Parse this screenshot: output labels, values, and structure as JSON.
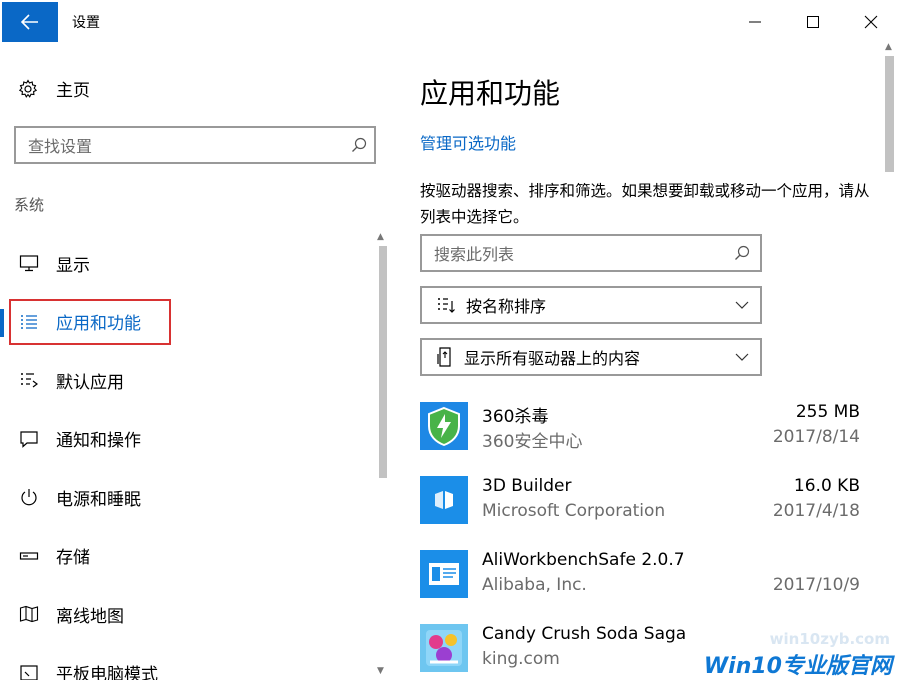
{
  "window": {
    "title": "设置",
    "back_icon": "back-arrow-icon",
    "accent": "#0a68c6"
  },
  "left": {
    "home_label": "主页",
    "search_placeholder": "查找设置",
    "section": "系统",
    "items": [
      {
        "label": "显示",
        "icon": "display-icon"
      },
      {
        "label": "应用和功能",
        "icon": "apps-list-icon",
        "selected": true
      },
      {
        "label": "默认应用",
        "icon": "default-apps-icon"
      },
      {
        "label": "通知和操作",
        "icon": "notification-icon"
      },
      {
        "label": "电源和睡眠",
        "icon": "power-icon"
      },
      {
        "label": "存储",
        "icon": "storage-icon"
      },
      {
        "label": "离线地图",
        "icon": "map-icon"
      },
      {
        "label": "平板电脑模式",
        "icon": "tablet-icon"
      }
    ]
  },
  "right": {
    "title": "应用和功能",
    "manage_link": "管理可选功能",
    "description": "按驱动器搜索、排序和筛选。如果想要卸载或移动一个应用，请从列表中选择它。",
    "search_placeholder": "搜索此列表",
    "sort_label": "按名称排序",
    "drive_label": "显示所有驱动器上的内容",
    "apps": [
      {
        "name": "360杀毒",
        "publisher": "360安全中心",
        "size": "255 MB",
        "date": "2017/8/14",
        "icon": "shield-icon"
      },
      {
        "name": "3D Builder",
        "publisher": "Microsoft Corporation",
        "size": "16.0 KB",
        "date": "2017/4/18",
        "icon": "3d-builder-icon"
      },
      {
        "name": "AliWorkbenchSafe 2.0.7",
        "publisher": "Alibaba, Inc.",
        "size": "",
        "date": "2017/10/9",
        "icon": "app-window-icon"
      },
      {
        "name": "Candy Crush Soda Saga",
        "publisher": "king.com",
        "size": "",
        "date": "",
        "icon": "candy-crush-icon"
      }
    ]
  },
  "watermark": {
    "url": "win10zyb.com",
    "main": "Win10专业版官网"
  }
}
